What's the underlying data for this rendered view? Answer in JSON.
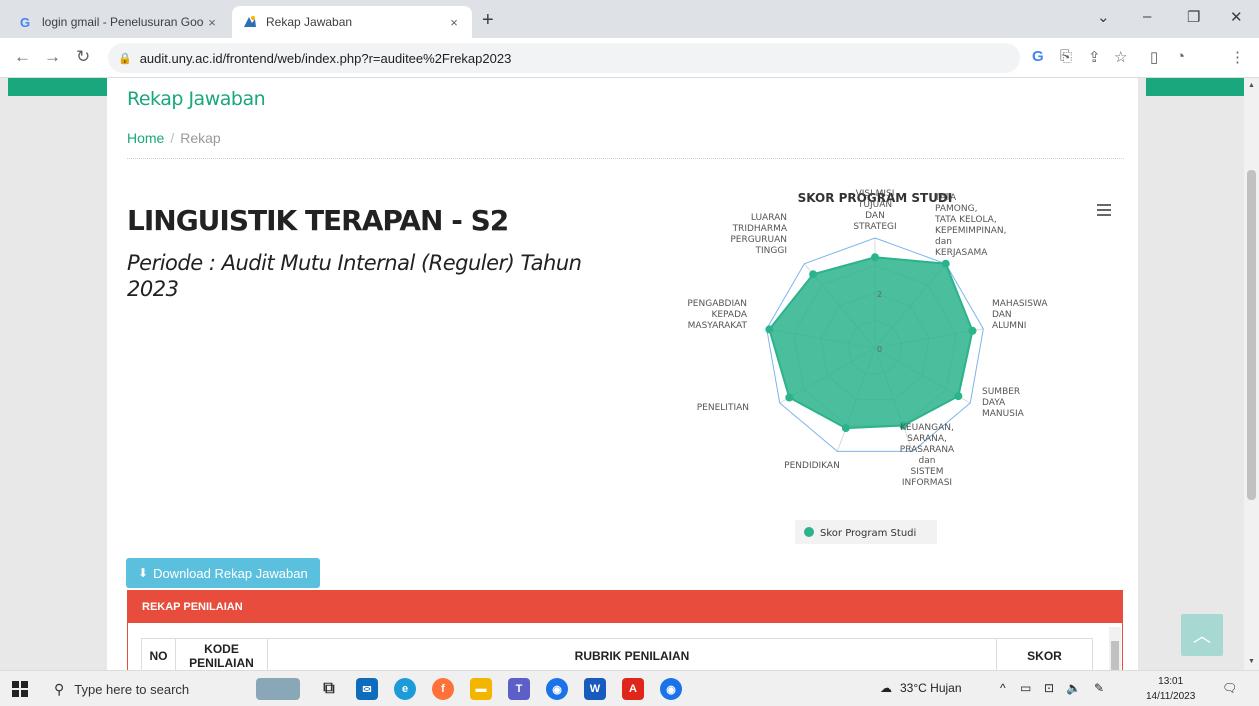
{
  "browser": {
    "tabs": [
      {
        "title": "login gmail - Penelusuran Googl",
        "close": "×"
      },
      {
        "title": "Rekap Jawaban",
        "close": "×"
      }
    ],
    "new_tab": "+",
    "url": "audit.uny.ac.id/frontend/web/index.php?r=auditee%2Frekap2023"
  },
  "page": {
    "title": "Rekap Jawaban",
    "breadcrumb": {
      "home": "Home",
      "separator": "/",
      "current": "Rekap"
    },
    "program": "LINGUISTIK TERAPAN - S2",
    "periode": "Periode : Audit Mutu Internal (Reguler) Tahun 2023",
    "download_label": "Download Rekap Jawaban",
    "panel_title": "REKAP PENILAIAN",
    "table_headers": {
      "no": "NO",
      "kode": "KODE PENILAIAN",
      "rubrik": "RUBRIK PENILAIAN",
      "skor": "SKOR"
    }
  },
  "chart_data": {
    "type": "radar",
    "title": "SKOR PROGRAM STUDI",
    "categories": [
      "VISI MISI TUJUAN DAN STRATEGI",
      "TATA PAMONG, TATA KELOLA, KEPEMIMPINAN, dan KERJASAMA",
      "MAHASISWA DAN ALUMNI",
      "SUMBER DAYA MANUSIA",
      "KEUANGAN, SARANA, PRASARANA dan SISTEM INFORMASI",
      "PENDIDIKAN",
      "PENELITIAN",
      "PENGABDIAN KEPADA MASYARAKAT",
      "LUARAN TRIDHARMA PERGURUAN TINGGI"
    ],
    "radial_ticks": [
      0,
      2
    ],
    "max": 4,
    "series": [
      {
        "name": "Skor Program Studi",
        "color": "#2bb38c",
        "values": [
          3.3,
          4,
          3.6,
          3.5,
          3.0,
          3.1,
          3.6,
          3.9,
          3.5
        ]
      }
    ]
  },
  "taskbar": {
    "search_placeholder": "Type here to search",
    "weather": "33°C Hujan",
    "time": "13:01",
    "date": "14/11/2023"
  },
  "colors": {
    "brand": "#1aa77d",
    "panel": "#e74c3c",
    "button": "#5bc0de"
  }
}
